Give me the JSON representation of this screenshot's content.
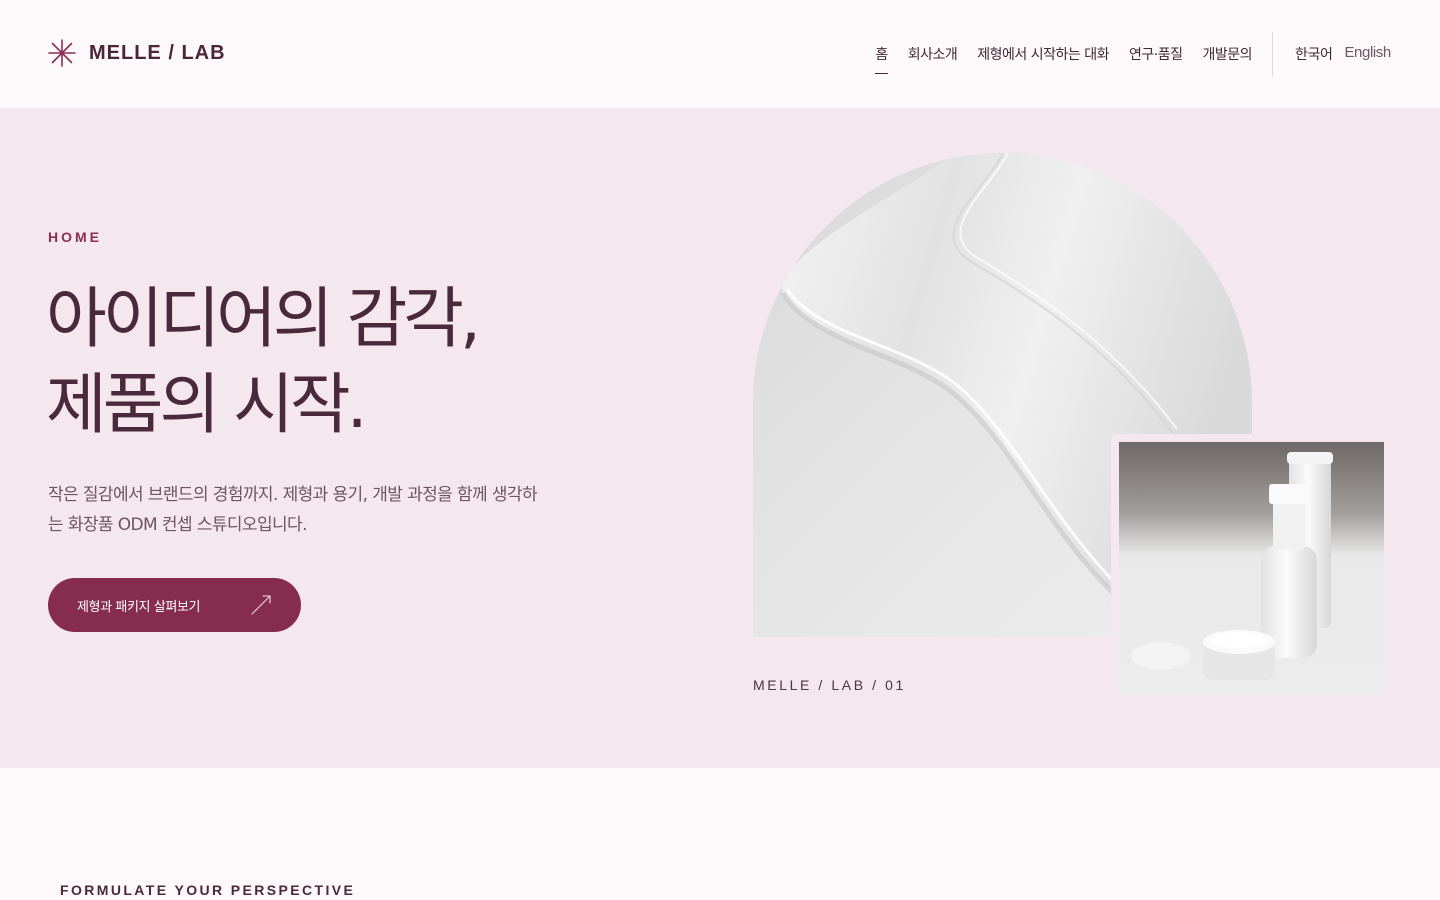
{
  "brand": {
    "name": "MELLE / LAB",
    "logo_icon": "asterisk-star-icon",
    "accent_color": "#862c4e"
  },
  "nav": {
    "items": [
      {
        "label": "홈",
        "active": true
      },
      {
        "label": "회사소개",
        "active": false
      },
      {
        "label": "제형에서 시작하는 대화",
        "active": false
      },
      {
        "label": "연구·품질",
        "active": false
      },
      {
        "label": "개발문의",
        "active": false
      }
    ],
    "languages": [
      "한국어",
      "English"
    ]
  },
  "hero": {
    "eyebrow": "HOME",
    "title_line1": "아이디어의 감각,",
    "title_line2": "제품의 시작.",
    "description": "작은 질감에서 브랜드의 경험까지. 제형과 용기, 개발 과정을 함께 생각하는 화장품 ODM 컨셉 스튜디오입니다.",
    "cta_label": "제형과 패키지 살펴보기",
    "cta_icon": "arrow-up-right-icon",
    "caption": "MELLE / LAB / 01",
    "main_image": "cream-texture-swirl",
    "secondary_image": "cosmetic-bottles-and-jar"
  },
  "next_section": {
    "label": "FORMULATE YOUR PERSPECTIVE"
  }
}
